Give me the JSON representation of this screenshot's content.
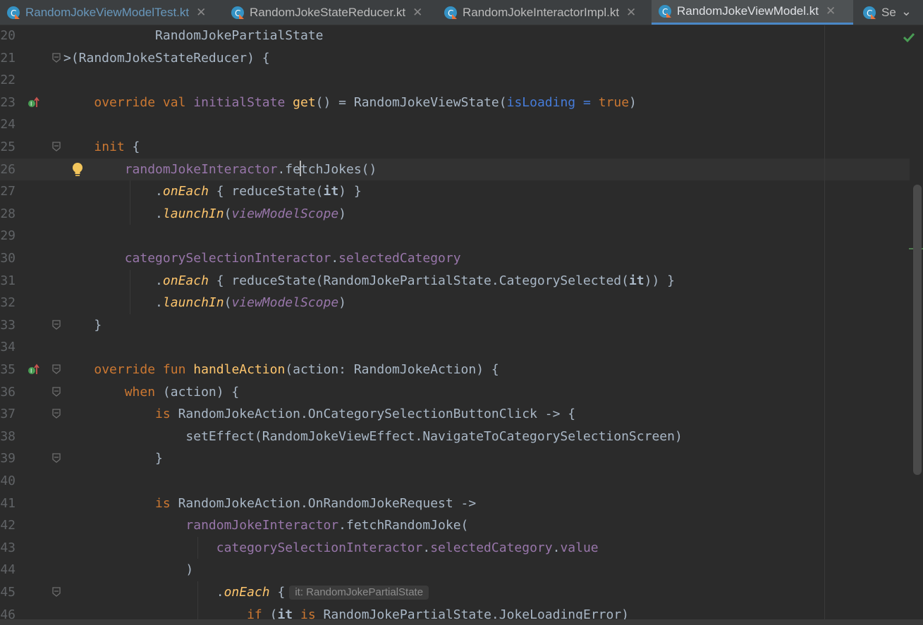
{
  "tabs": [
    {
      "label": "RandomJokeViewModelTest.kt",
      "icon": "kotlin-class-icon"
    },
    {
      "label": "RandomJokeStateReducer.kt",
      "icon": "kotlin-class-icon"
    },
    {
      "label": "RandomJokeInteractorImpl.kt",
      "icon": "kotlin-class-icon"
    },
    {
      "label": "RandomJokeViewModel.kt",
      "icon": "kotlin-class-icon",
      "active": true
    },
    {
      "label": "Se",
      "icon": "kotlin-class-icon"
    }
  ],
  "colors": {
    "background": "#2b2b2b",
    "keyword": "#cc7832",
    "function": "#ffc66d",
    "property": "#9876aa",
    "named_arg": "#467cda",
    "default_text": "#a9b7c6",
    "active_tab_underline": "#4a88c7",
    "inspection_ok": "#499c54"
  },
  "status": {
    "inspection_icon": "green-check-icon"
  },
  "inlay_hint": "it: RandomJokePartialState",
  "lines": [
    {
      "n": "20"
    },
    {
      "n": "21"
    },
    {
      "n": "22"
    },
    {
      "n": "23"
    },
    {
      "n": "24"
    },
    {
      "n": "25"
    },
    {
      "n": "26"
    },
    {
      "n": "27"
    },
    {
      "n": "28"
    },
    {
      "n": "29"
    },
    {
      "n": "30"
    },
    {
      "n": "31"
    },
    {
      "n": "32"
    },
    {
      "n": "33"
    },
    {
      "n": "34"
    },
    {
      "n": "35"
    },
    {
      "n": "36"
    },
    {
      "n": "37"
    },
    {
      "n": "38"
    },
    {
      "n": "39"
    },
    {
      "n": "40"
    },
    {
      "n": "41"
    },
    {
      "n": "42"
    },
    {
      "n": "43"
    },
    {
      "n": "44"
    },
    {
      "n": "45"
    },
    {
      "n": "46"
    }
  ],
  "tokens": {
    "l20": [
      "    RandomJokePartialState"
    ],
    "l21": [
      ">(RandomJokeStateReducer) {"
    ],
    "l23": [
      "override",
      " ",
      "val",
      " ",
      "initialState",
      " ",
      "get",
      "() = RandomJokeViewState(",
      "isLoading",
      " ",
      "=",
      " ",
      "true",
      ")"
    ],
    "l25": [
      "init",
      " {"
    ],
    "l26": [
      "randomJokeInteractor",
      ".fe",
      "tchJokes",
      "()"
    ],
    "l27": [
      ".",
      "onEach",
      " { reduceState(",
      "it",
      ") }"
    ],
    "l28": [
      ".",
      "launchIn",
      "(",
      "viewModelScope",
      ")"
    ],
    "l30": [
      "categorySelectionInteractor",
      ".",
      "selectedCategory"
    ],
    "l31": [
      ".",
      "onEach",
      " { reduceState(RandomJokePartialState.CategorySelected(",
      "it",
      ")) }"
    ],
    "l32": [
      ".",
      "launchIn",
      "(",
      "viewModelScope",
      ")"
    ],
    "l33": [
      "}"
    ],
    "l35": [
      "override",
      " ",
      "fun",
      " ",
      "handleAction",
      "(action: RandomJokeAction) {"
    ],
    "l36": [
      "when",
      " (action) {"
    ],
    "l37": [
      "is",
      " RandomJokeAction.OnCategorySelectionButtonClick -> {"
    ],
    "l38": [
      "setEffect(RandomJokeViewEffect.NavigateToCategorySelectionScreen)"
    ],
    "l39": [
      "}"
    ],
    "l41": [
      "is",
      " RandomJokeAction.OnRandomJokeRequest ->"
    ],
    "l42": [
      "randomJokeInteractor",
      ".fetchRandomJoke("
    ],
    "l43": [
      "categorySelectionInteractor",
      ".",
      "selectedCategory",
      ".",
      "value"
    ],
    "l44": [
      ")"
    ],
    "l45": [
      ".",
      "onEach",
      " {"
    ],
    "l46": [
      "if",
      " (",
      "it",
      " ",
      "is",
      " RandomJokePartialState.JokeLoadingError)"
    ]
  }
}
